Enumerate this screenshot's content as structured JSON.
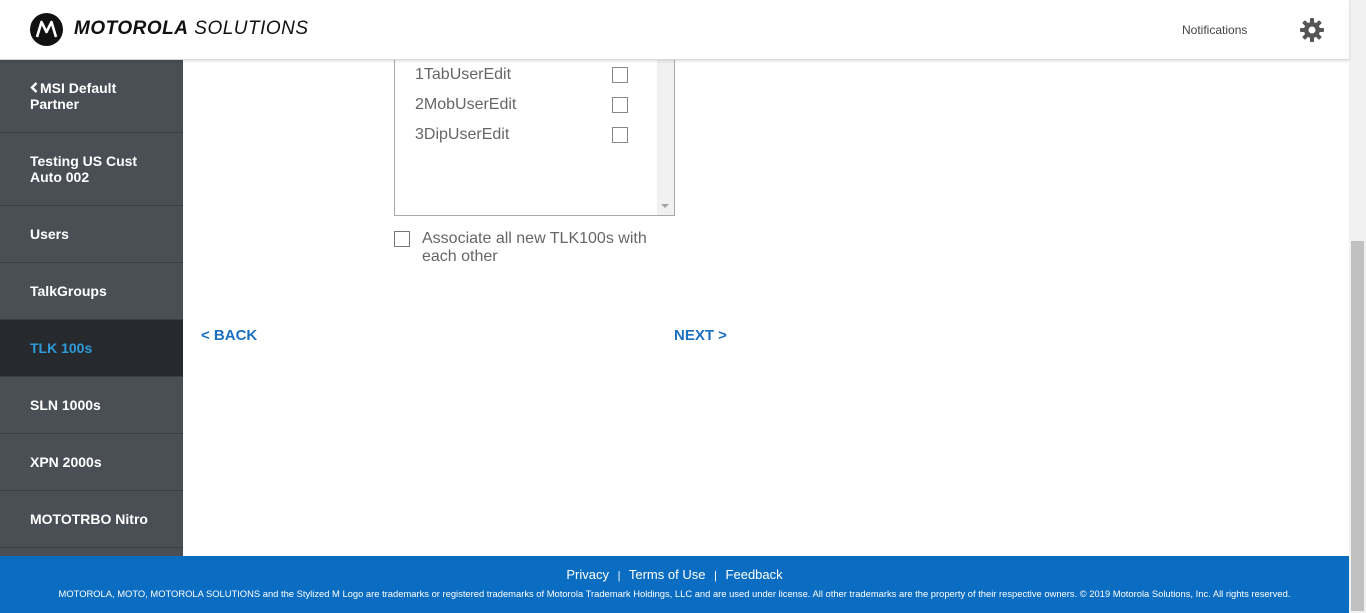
{
  "header": {
    "brand_bold": "MOTOROLA",
    "brand_light": "SOLUTIONS",
    "notifications_label": "Notifications"
  },
  "sidebar": {
    "items": [
      {
        "label": "MSI Default Partner",
        "icon": "chevron-left-icon"
      },
      {
        "label": "Testing US Cust Auto 002"
      },
      {
        "label": "Users"
      },
      {
        "label": "TalkGroups"
      },
      {
        "label": "TLK 100s",
        "active": true
      },
      {
        "label": "SLN 1000s"
      },
      {
        "label": "XPN 2000s"
      },
      {
        "label": "MOTOTRBO Nitro"
      }
    ]
  },
  "main": {
    "list_items": [
      {
        "label": "1TabUserEdit",
        "checked": false
      },
      {
        "label": "2MobUserEdit",
        "checked": false
      },
      {
        "label": "3DipUserEdit",
        "checked": false
      }
    ],
    "associate_label": "Associate all new TLK100s with each other",
    "associate_checked": false,
    "back_label": "< BACK",
    "next_label": "NEXT >"
  },
  "footer": {
    "links": [
      "Privacy",
      "Terms of Use",
      "Feedback"
    ],
    "separator": "|",
    "legal": "MOTOROLA, MOTO, MOTOROLA SOLUTIONS and the Stylized M Logo are trademarks or registered trademarks of Motorola Trademark Holdings, LLC and are used under license. All other trademarks are the property of their respective owners. © 2019 Motorola Solutions, Inc. All rights reserved."
  },
  "colors": {
    "sidebar_bg": "#4a4f55",
    "sidebar_active_bg": "#262a2e",
    "sidebar_active_text": "#2e9bd8",
    "link_blue": "#1c6fbf",
    "footer_bg": "#0a6dc2"
  }
}
